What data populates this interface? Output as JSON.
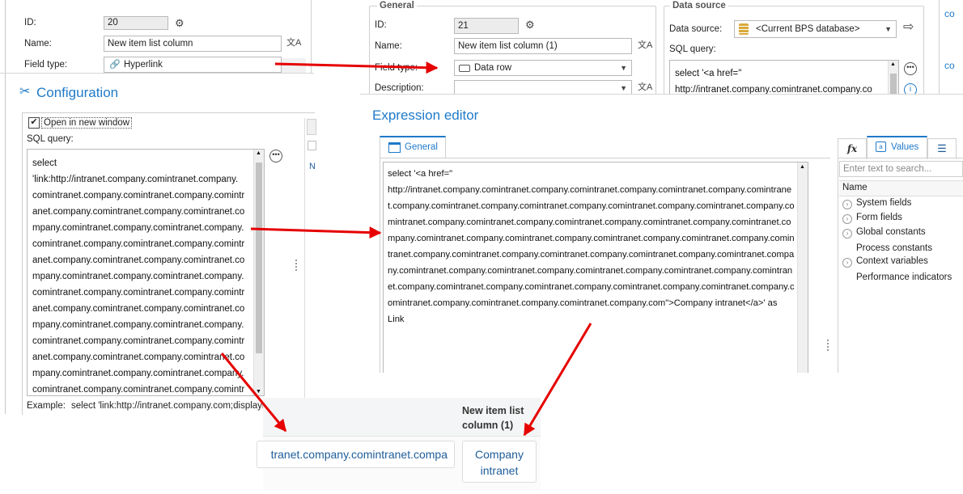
{
  "top_left": {
    "id_label": "ID:",
    "id_value": "20",
    "name_label": "Name:",
    "name_value": "New item list column",
    "field_type_label": "Field type:",
    "field_type_value": "Hyperlink"
  },
  "configuration": {
    "title": "Configuration",
    "open_new_window_label": "Open in new window",
    "open_new_window_checked": true,
    "sql_label": "SQL query:",
    "sql_lines": [
      "select",
      "'link:http://intranet.company.comintranet.company.",
      "comintranet.company.comintranet.company.comintr",
      "anet.company.comintranet.company.comintranet.co",
      "mpany.comintranet.company.comintranet.company.",
      "comintranet.company.comintranet.company.comintr",
      "anet.company.comintranet.company.comintranet.co",
      "mpany.comintranet.company.comintranet.company.",
      "comintranet.company.comintranet.company.comintr",
      "anet.company.comintranet.company.comintranet.co",
      "mpany.comintranet.company.comintranet.company.",
      "comintranet.company.comintranet.company.comintr",
      "anet.company.comintranet.company.comintranet.co",
      "mpany.comintranet.company.comintranet.company.",
      "comintranet.company.comintranet.company.comintr"
    ],
    "example_label": "Example:",
    "example_value": "select 'link:http://intranet.company.com;displayna"
  },
  "top_right": {
    "general_group": "General",
    "id_label": "ID:",
    "id_value": "21",
    "name_label": "Name:",
    "name_value": "New item list column (1)",
    "field_type_label": "Field type:",
    "field_type_value": "Data row",
    "description_label": "Description:",
    "description_value": "",
    "datasource_group": "Data source",
    "datasource_label": "Data source:",
    "datasource_value": "<Current BPS database>",
    "sql_label": "SQL query:",
    "sql_lines": [
      "select '<a href=\"",
      "http://intranet.company.comintranet.company.co"
    ],
    "edge_text_1": "co",
    "edge_text_2": "co"
  },
  "expression_editor": {
    "title": "Expression editor",
    "tab_general": "General",
    "code_lines": [
      "select '<a href=\"",
      "http://intranet.company.comintranet.company.comintranet.company.comintranet.company.comintrane",
      "t.company.comintranet.company.comintranet.company.comintranet.company.comintranet.company.co",
      "mintranet.company.comintranet.company.comintranet.company.comintranet.company.comintranet.co",
      "mpany.comintranet.company.comintranet.company.comintranet.company.comintranet.company.comin",
      "tranet.company.comintranet.company.comintranet.company.comintranet.company.comintranet.compa",
      "ny.comintranet.company.comintranet.company.comintranet.company.comintranet.company.comintran",
      "et.company.comintranet.company.comintranet.company.comintranet.company.comintranet.company.c",
      "omintranet.company.comintranet.company.comintranet.company.com\">Company intranet</a>' as",
      "Link"
    ],
    "tab_fx": "fx",
    "tab_values": "Values",
    "search_placeholder": "Enter text to search...",
    "tree_header": "Name",
    "tree_items": [
      {
        "label": "System fields",
        "expandable": true
      },
      {
        "label": "Form fields",
        "expandable": true
      },
      {
        "label": "Global constants",
        "expandable": true
      },
      {
        "label": "Process constants",
        "expandable": false
      },
      {
        "label": "Context variables",
        "expandable": true
      },
      {
        "label": "Performance indicators",
        "expandable": false
      }
    ]
  },
  "result_grid": {
    "column_header_line1": "New item list",
    "column_header_line2": "column (1)",
    "left_cell": "tranet.company.comintranet.compa",
    "button_line1": "Company",
    "button_line2": "intranet"
  },
  "colors": {
    "accent_blue": "#1f7ac9",
    "arrow_red": "#e60000",
    "link_blue": "#1e5d9a"
  }
}
